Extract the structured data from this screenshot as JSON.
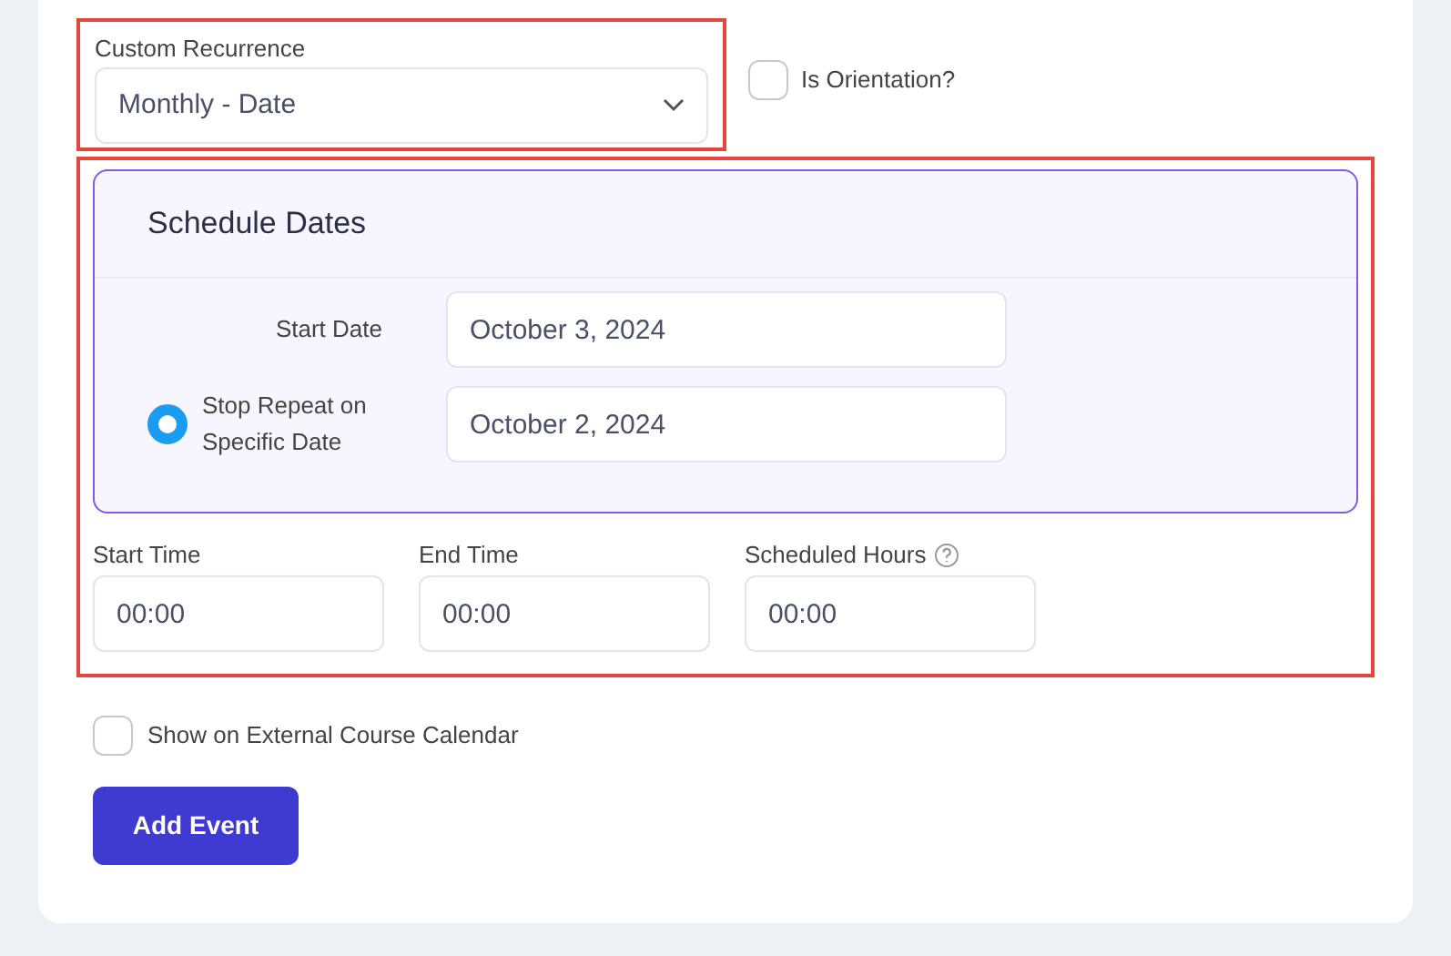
{
  "recurrence": {
    "label": "Custom Recurrence",
    "value": "Monthly - Date"
  },
  "orientation": {
    "label": "Is Orientation?",
    "checked": false
  },
  "schedule": {
    "title": "Schedule Dates",
    "rows": [
      {
        "kind": "label",
        "label": "Start Date",
        "value": "October 3, 2024"
      },
      {
        "kind": "radio",
        "label": "Stop Repeat on Specific Date",
        "selected": true,
        "value": "October 2, 2024"
      }
    ]
  },
  "times": [
    {
      "label": "Start Time",
      "value": "00:00",
      "help": false
    },
    {
      "label": "End Time",
      "value": "00:00",
      "help": false
    },
    {
      "label": "Scheduled Hours",
      "value": "00:00",
      "help": true
    }
  ],
  "external_calendar": {
    "label": "Show on External Course Calendar",
    "checked": false
  },
  "submit": "Add Event"
}
